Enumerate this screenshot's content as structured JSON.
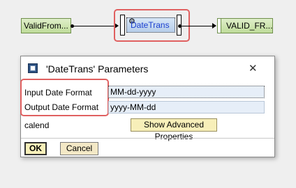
{
  "canvas": {
    "nodes": [
      "ValidFrom...",
      "DateTrans",
      "VALID_FR..."
    ]
  },
  "dialog": {
    "title": "'DateTrans' Parameters",
    "close_glyph": "✕",
    "params": [
      {
        "label": "Input Date Format",
        "value": "MM-dd-yyyy"
      },
      {
        "label": "Output Date Format",
        "value": "yyyy-MM-dd"
      },
      {
        "label": "calend"
      }
    ],
    "advanced_button": "Show Advanced Properties",
    "ok_label": "OK",
    "cancel_label": "Cancel"
  }
}
